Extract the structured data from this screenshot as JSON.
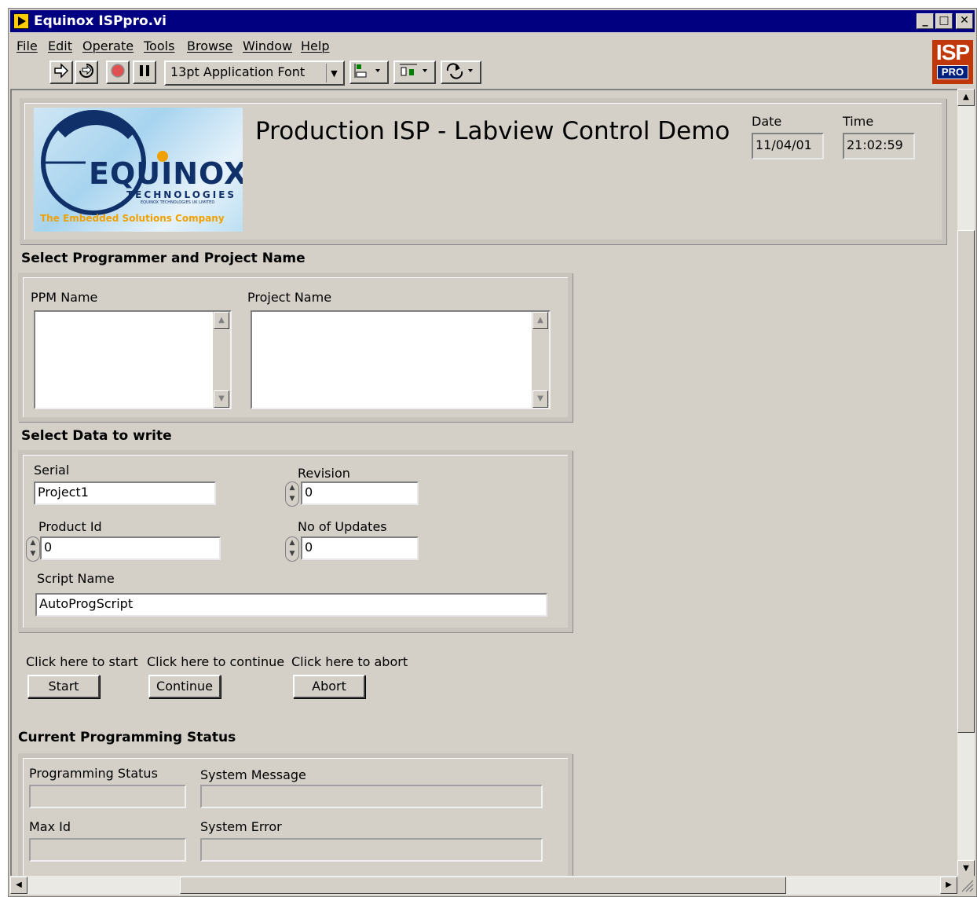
{
  "window": {
    "title": "Equinox ISPpro.vi",
    "controls": {
      "minimize": "_",
      "maximize": "□",
      "close": "✕"
    }
  },
  "menu": [
    "File",
    "Edit",
    "Operate",
    "Tools",
    "Browse",
    "Window",
    "Help"
  ],
  "toolbar": {
    "font": "13pt Application Font",
    "icons": [
      "run-arrow-icon",
      "run-continuous-icon",
      "abort-execution-icon",
      "pause-icon",
      "align-objects-icon",
      "distribute-objects-icon",
      "reorder-objects-icon"
    ]
  },
  "isp_logo": {
    "top": "ISP",
    "bottom": "PRO"
  },
  "header": {
    "title": "Production ISP - Labview Control Demo",
    "date_label": "Date",
    "date_value": "11/04/01",
    "time_label": "Time",
    "time_value": "21:02:59"
  },
  "logo": {
    "brand": "EQUINOX",
    "sub": "TECHNOLOGIES",
    "tiny": "EQUINOX TECHNOLOGIES UK LIMITED",
    "tagline": "The Embedded Solutions Company"
  },
  "programmer_section": {
    "heading": "Select Programmer and Project Name",
    "ppm_label": "PPM Name",
    "project_label": "Project Name"
  },
  "data_section": {
    "heading": "Select Data to write",
    "serial_label": "Serial",
    "serial_value": "Project1",
    "revision_label": "Revision",
    "revision_value": "0",
    "product_id_label": "Product Id",
    "product_id_value": "0",
    "updates_label": "No of Updates",
    "updates_value": "0",
    "script_label": "Script Name",
    "script_value": "AutoProgScript"
  },
  "actions": {
    "start_caption": "Click here to start",
    "start_label": "Start",
    "continue_caption": "Click here to continue",
    "continue_label": "Continue",
    "abort_caption": "Click here to abort",
    "abort_label": "Abort"
  },
  "status_section": {
    "heading": "Current Programming Status",
    "programming_status_label": "Programming Status",
    "system_message_label": "System Message",
    "max_id_label": "Max Id",
    "system_error_label": "System Error"
  },
  "colors": {
    "title_bar": "#000080",
    "panel": "#d4d0c8",
    "logo_blue": "#1a3a7a",
    "logo_orange": "#f0a000"
  }
}
